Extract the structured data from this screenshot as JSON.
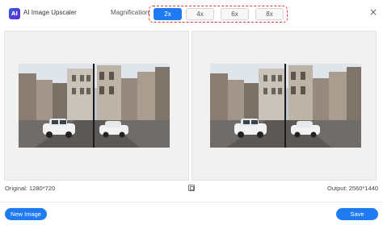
{
  "header": {
    "app_title": "AI Image Upscaler",
    "logo_icon": "upscaler-logo-icon",
    "magnification_label": "Magnification:",
    "magnification_options": [
      "2x",
      "4x",
      "6x",
      "8x"
    ],
    "selected_magnification": "2x",
    "close_label": "×"
  },
  "preview": {
    "original_label": "Original: 1280*720",
    "output_label": "Output: 2560*1440",
    "image_subject": "city street with white car"
  },
  "footer": {
    "new_image_label": "New Image",
    "save_label": "Save"
  },
  "colors": {
    "accent": "#1f7bf2",
    "highlight_border": "#e53935"
  }
}
